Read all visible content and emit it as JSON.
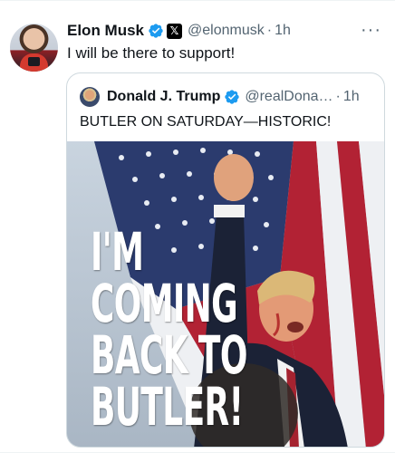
{
  "post": {
    "author": {
      "name": "Elon Musk",
      "handle": "@elonmusk",
      "time": "1h"
    },
    "separator": "·",
    "more": "···",
    "text": "I will be there to support!",
    "x_badge": "𝕏"
  },
  "quoted": {
    "author": {
      "name": "Donald J. Trump",
      "handle": "@realDona…",
      "time": "1h"
    },
    "separator": "·",
    "text": "BUTLER ON SATURDAY—HISTORIC!",
    "image_text": [
      "I'M",
      "COMING",
      "BACK TO",
      "BUTLER!"
    ]
  },
  "colors": {
    "verified": "#1d9bf0",
    "secondary_text": "#536471",
    "border": "#cfd9de",
    "flag_red": "#b22234",
    "flag_blue": "#2b3b6e"
  },
  "icons": [
    "verified-badge-icon",
    "x-logo-icon",
    "more-options-icon"
  ]
}
